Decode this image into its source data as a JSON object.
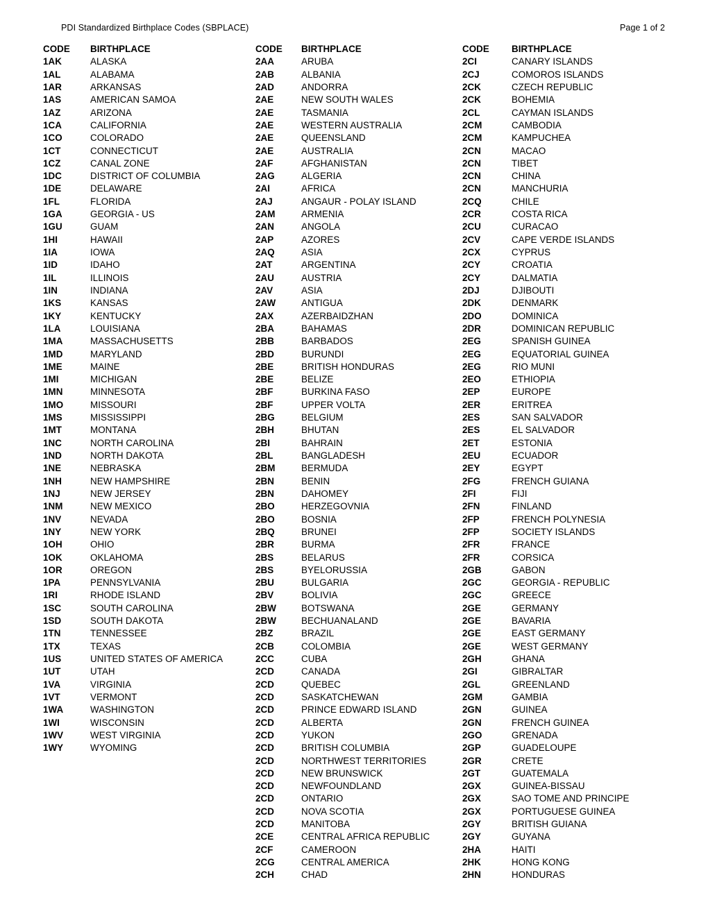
{
  "header": {
    "title": "PDI Standardized Birthplace Codes (SBPLACE)",
    "page_label": "Page 1 of 2"
  },
  "table": {
    "headers": {
      "code": "CODE",
      "birthplace": "BIRTHPLACE"
    },
    "columns": [
      {
        "id": "column-1",
        "rows": [
          {
            "code": "1AK",
            "place": "ALASKA"
          },
          {
            "code": "1AL",
            "place": "ALABAMA"
          },
          {
            "code": "1AR",
            "place": "ARKANSAS"
          },
          {
            "code": "1AS",
            "place": "AMERICAN SAMOA"
          },
          {
            "code": "1AZ",
            "place": "ARIZONA"
          },
          {
            "code": "1CA",
            "place": "CALIFORNIA"
          },
          {
            "code": "1CO",
            "place": "COLORADO"
          },
          {
            "code": "1CT",
            "place": "CONNECTICUT"
          },
          {
            "code": "1CZ",
            "place": "CANAL ZONE"
          },
          {
            "code": "1DC",
            "place": "DISTRICT OF COLUMBIA"
          },
          {
            "code": "1DE",
            "place": "DELAWARE"
          },
          {
            "code": "1FL",
            "place": "FLORIDA"
          },
          {
            "code": "1GA",
            "place": "GEORGIA - US"
          },
          {
            "code": "1GU",
            "place": "GUAM"
          },
          {
            "code": "1HI",
            "place": "HAWAII"
          },
          {
            "code": "1IA",
            "place": "IOWA"
          },
          {
            "code": "1ID",
            "place": "IDAHO"
          },
          {
            "code": "1IL",
            "place": "ILLINOIS"
          },
          {
            "code": "1IN",
            "place": "INDIANA"
          },
          {
            "code": "1KS",
            "place": "KANSAS"
          },
          {
            "code": "1KY",
            "place": "KENTUCKY"
          },
          {
            "code": "1LA",
            "place": "LOUISIANA"
          },
          {
            "code": "1MA",
            "place": "MASSACHUSETTS"
          },
          {
            "code": "1MD",
            "place": "MARYLAND"
          },
          {
            "code": "1ME",
            "place": "MAINE"
          },
          {
            "code": "1MI",
            "place": "MICHIGAN"
          },
          {
            "code": "1MN",
            "place": "MINNESOTA"
          },
          {
            "code": "1MO",
            "place": "MISSOURI"
          },
          {
            "code": "1MS",
            "place": "MISSISSIPPI"
          },
          {
            "code": "1MT",
            "place": "MONTANA"
          },
          {
            "code": "1NC",
            "place": "NORTH CAROLINA"
          },
          {
            "code": "1ND",
            "place": "NORTH DAKOTA"
          },
          {
            "code": "1NE",
            "place": "NEBRASKA"
          },
          {
            "code": "1NH",
            "place": "NEW HAMPSHIRE"
          },
          {
            "code": "1NJ",
            "place": "NEW JERSEY"
          },
          {
            "code": "1NM",
            "place": "NEW MEXICO"
          },
          {
            "code": "1NV",
            "place": "NEVADA"
          },
          {
            "code": "1NY",
            "place": "NEW YORK"
          },
          {
            "code": "1OH",
            "place": "OHIO"
          },
          {
            "code": "1OK",
            "place": "OKLAHOMA"
          },
          {
            "code": "1OR",
            "place": "OREGON"
          },
          {
            "code": "1PA",
            "place": "PENNSYLVANIA"
          },
          {
            "code": "1RI",
            "place": "RHODE ISLAND"
          },
          {
            "code": "1SC",
            "place": "SOUTH CAROLINA"
          },
          {
            "code": "1SD",
            "place": "SOUTH DAKOTA"
          },
          {
            "code": "1TN",
            "place": "TENNESSEE"
          },
          {
            "code": "1TX",
            "place": "TEXAS"
          },
          {
            "code": "1US",
            "place": "UNITED STATES OF AMERICA"
          },
          {
            "code": "1UT",
            "place": "UTAH"
          },
          {
            "code": "1VA",
            "place": "VIRGINIA"
          },
          {
            "code": "1VT",
            "place": "VERMONT"
          },
          {
            "code": "1WA",
            "place": "WASHINGTON"
          },
          {
            "code": "1WI",
            "place": "WISCONSIN"
          },
          {
            "code": "1WV",
            "place": "WEST VIRGINIA"
          },
          {
            "code": "1WY",
            "place": "WYOMING"
          }
        ]
      },
      {
        "id": "column-2",
        "rows": [
          {
            "code": "2AA",
            "place": "ARUBA"
          },
          {
            "code": "2AB",
            "place": "ALBANIA"
          },
          {
            "code": "2AD",
            "place": "ANDORRA"
          },
          {
            "code": "2AE",
            "place": "NEW SOUTH WALES"
          },
          {
            "code": "2AE",
            "place": "TASMANIA"
          },
          {
            "code": "2AE",
            "place": "WESTERN AUSTRALIA"
          },
          {
            "code": "2AE",
            "place": "QUEENSLAND"
          },
          {
            "code": "2AE",
            "place": "AUSTRALIA"
          },
          {
            "code": "2AF",
            "place": "AFGHANISTAN"
          },
          {
            "code": "2AG",
            "place": "ALGERIA"
          },
          {
            "code": "2AI",
            "place": "AFRICA"
          },
          {
            "code": "2AJ",
            "place": "ANGAUR - POLAY ISLAND"
          },
          {
            "code": "2AM",
            "place": "ARMENIA"
          },
          {
            "code": "2AN",
            "place": "ANGOLA"
          },
          {
            "code": "2AP",
            "place": "AZORES"
          },
          {
            "code": "2AQ",
            "place": "ASIA"
          },
          {
            "code": "2AT",
            "place": "ARGENTINA"
          },
          {
            "code": "2AU",
            "place": "AUSTRIA"
          },
          {
            "code": "2AV",
            "place": "ASIA"
          },
          {
            "code": "2AW",
            "place": "ANTIGUA"
          },
          {
            "code": "2AX",
            "place": "AZERBAIDZHAN"
          },
          {
            "code": "2BA",
            "place": "BAHAMAS"
          },
          {
            "code": "2BB",
            "place": "BARBADOS"
          },
          {
            "code": "2BD",
            "place": "BURUNDI"
          },
          {
            "code": "2BE",
            "place": "BRITISH HONDURAS"
          },
          {
            "code": "2BE",
            "place": "BELIZE"
          },
          {
            "code": "2BF",
            "place": "BURKINA FASO"
          },
          {
            "code": "2BF",
            "place": "UPPER VOLTA"
          },
          {
            "code": "2BG",
            "place": "BELGIUM"
          },
          {
            "code": "2BH",
            "place": "BHUTAN"
          },
          {
            "code": "2BI",
            "place": "BAHRAIN"
          },
          {
            "code": "2BL",
            "place": "BANGLADESH"
          },
          {
            "code": "2BM",
            "place": "BERMUDA"
          },
          {
            "code": "2BN",
            "place": "BENIN"
          },
          {
            "code": "2BN",
            "place": "DAHOMEY"
          },
          {
            "code": "2BO",
            "place": "HERZEGOVNIA"
          },
          {
            "code": "2BO",
            "place": "BOSNIA"
          },
          {
            "code": "2BQ",
            "place": "BRUNEI"
          },
          {
            "code": "2BR",
            "place": "BURMA"
          },
          {
            "code": "2BS",
            "place": "BELARUS"
          },
          {
            "code": "2BS",
            "place": "BYELORUSSIA"
          },
          {
            "code": "2BU",
            "place": "BULGARIA"
          },
          {
            "code": "2BV",
            "place": "BOLIVIA"
          },
          {
            "code": "2BW",
            "place": "BOTSWANA"
          },
          {
            "code": "2BW",
            "place": "BECHUANALAND"
          },
          {
            "code": "2BZ",
            "place": "BRAZIL"
          },
          {
            "code": "2CB",
            "place": "COLOMBIA"
          },
          {
            "code": "2CC",
            "place": "CUBA"
          },
          {
            "code": "2CD",
            "place": "CANADA"
          },
          {
            "code": "2CD",
            "place": "QUEBEC"
          },
          {
            "code": "2CD",
            "place": "SASKATCHEWAN"
          },
          {
            "code": "2CD",
            "place": "PRINCE EDWARD ISLAND"
          },
          {
            "code": "2CD",
            "place": "ALBERTA"
          },
          {
            "code": "2CD",
            "place": "YUKON"
          },
          {
            "code": "2CD",
            "place": "BRITISH COLUMBIA"
          },
          {
            "code": "2CD",
            "place": "NORTHWEST TERRITORIES"
          },
          {
            "code": "2CD",
            "place": "NEW BRUNSWICK"
          },
          {
            "code": "2CD",
            "place": "NEWFOUNDLAND"
          },
          {
            "code": "2CD",
            "place": "ONTARIO"
          },
          {
            "code": "2CD",
            "place": "NOVA SCOTIA"
          },
          {
            "code": "2CD",
            "place": "MANITOBA"
          },
          {
            "code": "2CE",
            "place": "CENTRAL AFRICA REPUBLIC"
          },
          {
            "code": "2CF",
            "place": "CAMEROON"
          },
          {
            "code": "2CG",
            "place": "CENTRAL AMERICA"
          },
          {
            "code": "2CH",
            "place": "CHAD"
          }
        ]
      },
      {
        "id": "column-3",
        "rows": [
          {
            "code": "2CI",
            "place": "CANARY ISLANDS"
          },
          {
            "code": "2CJ",
            "place": "COMOROS ISLANDS"
          },
          {
            "code": "2CK",
            "place": "CZECH REPUBLIC"
          },
          {
            "code": "2CK",
            "place": "BOHEMIA"
          },
          {
            "code": "2CL",
            "place": "CAYMAN ISLANDS"
          },
          {
            "code": "2CM",
            "place": "CAMBODIA"
          },
          {
            "code": "2CM",
            "place": "KAMPUCHEA"
          },
          {
            "code": "2CN",
            "place": "MACAO"
          },
          {
            "code": "2CN",
            "place": "TIBET"
          },
          {
            "code": "2CN",
            "place": "CHINA"
          },
          {
            "code": "2CN",
            "place": "MANCHURIA"
          },
          {
            "code": "2CQ",
            "place": "CHILE"
          },
          {
            "code": "2CR",
            "place": "COSTA RICA"
          },
          {
            "code": "2CU",
            "place": "CURACAO"
          },
          {
            "code": "2CV",
            "place": "CAPE VERDE ISLANDS"
          },
          {
            "code": "2CX",
            "place": "CYPRUS"
          },
          {
            "code": "2CY",
            "place": "CROATIA"
          },
          {
            "code": "2CY",
            "place": "DALMATIA"
          },
          {
            "code": "2DJ",
            "place": "DJIBOUTI"
          },
          {
            "code": "2DK",
            "place": "DENMARK"
          },
          {
            "code": "2DO",
            "place": "DOMINICA"
          },
          {
            "code": "2DR",
            "place": "DOMINICAN REPUBLIC"
          },
          {
            "code": "2EG",
            "place": "SPANISH GUINEA"
          },
          {
            "code": "2EG",
            "place": "EQUATORIAL GUINEA"
          },
          {
            "code": "2EG",
            "place": "RIO MUNI"
          },
          {
            "code": "2EO",
            "place": "ETHIOPIA"
          },
          {
            "code": "2EP",
            "place": "EUROPE"
          },
          {
            "code": "2ER",
            "place": "ERITREA"
          },
          {
            "code": "2ES",
            "place": "SAN SALVADOR"
          },
          {
            "code": "2ES",
            "place": "EL SALVADOR"
          },
          {
            "code": "2ET",
            "place": "ESTONIA"
          },
          {
            "code": "2EU",
            "place": "ECUADOR"
          },
          {
            "code": "2EY",
            "place": "EGYPT"
          },
          {
            "code": "2FG",
            "place": "FRENCH GUIANA"
          },
          {
            "code": "2FI",
            "place": "FIJI"
          },
          {
            "code": "2FN",
            "place": "FINLAND"
          },
          {
            "code": "2FP",
            "place": "FRENCH POLYNESIA"
          },
          {
            "code": "2FP",
            "place": "SOCIETY ISLANDS"
          },
          {
            "code": "2FR",
            "place": "FRANCE"
          },
          {
            "code": "2FR",
            "place": "CORSICA"
          },
          {
            "code": "2GB",
            "place": "GABON"
          },
          {
            "code": "2GC",
            "place": "GEORGIA - REPUBLIC"
          },
          {
            "code": "2GC",
            "place": "GREECE"
          },
          {
            "code": "2GE",
            "place": "GERMANY"
          },
          {
            "code": "2GE",
            "place": "BAVARIA"
          },
          {
            "code": "2GE",
            "place": "EAST GERMANY"
          },
          {
            "code": "2GE",
            "place": "WEST GERMANY"
          },
          {
            "code": "2GH",
            "place": "GHANA"
          },
          {
            "code": "2GI",
            "place": "GIBRALTAR"
          },
          {
            "code": "2GL",
            "place": "GREENLAND"
          },
          {
            "code": "2GM",
            "place": "GAMBIA"
          },
          {
            "code": "2GN",
            "place": "GUINEA"
          },
          {
            "code": "2GN",
            "place": "FRENCH GUINEA"
          },
          {
            "code": "2GO",
            "place": "GRENADA"
          },
          {
            "code": "2GP",
            "place": "GUADELOUPE"
          },
          {
            "code": "2GR",
            "place": "CRETE"
          },
          {
            "code": "2GT",
            "place": "GUATEMALA"
          },
          {
            "code": "2GX",
            "place": "GUINEA-BISSAU"
          },
          {
            "code": "2GX",
            "place": "SAO TOME AND PRINCIPE"
          },
          {
            "code": "2GX",
            "place": "PORTUGUESE GUINEA"
          },
          {
            "code": "2GY",
            "place": "BRITISH GUIANA"
          },
          {
            "code": "2GY",
            "place": "GUYANA"
          },
          {
            "code": "2HA",
            "place": "HAITI"
          },
          {
            "code": "2HK",
            "place": "HONG KONG"
          },
          {
            "code": "2HN",
            "place": "HONDURAS"
          }
        ]
      }
    ]
  }
}
